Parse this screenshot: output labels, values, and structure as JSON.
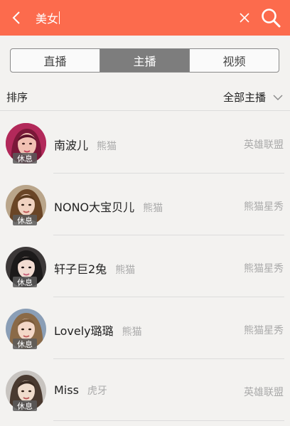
{
  "search": {
    "query": "美女"
  },
  "tabs": [
    {
      "label": "直播",
      "active": false
    },
    {
      "label": "主播",
      "active": true
    },
    {
      "label": "视频",
      "active": false
    }
  ],
  "sort": {
    "label": "排序",
    "filter_label": "全部主播"
  },
  "streamers": [
    {
      "name": "南波儿",
      "platform": "熊猫",
      "category": "英雄联盟",
      "status": "休息"
    },
    {
      "name": "NONO大宝贝儿",
      "platform": "熊猫",
      "category": "熊猫星秀",
      "status": "休息"
    },
    {
      "name": "轩子巨2兔",
      "platform": "熊猫",
      "category": "熊猫星秀",
      "status": "休息"
    },
    {
      "name": "Lovely璐璐",
      "platform": "熊猫",
      "category": "熊猫星秀",
      "status": "休息"
    },
    {
      "name": "Miss",
      "platform": "虎牙",
      "category": "英雄联盟",
      "status": "休息"
    }
  ],
  "colors": {
    "header_bg": "#fc6b4d",
    "active_tab_bg": "#7d7d7d",
    "page_bg": "#f3f2f0"
  },
  "icons": {
    "back": "back-arrow-icon",
    "clear": "clear-x-icon",
    "search": "search-icon",
    "chevron": "chevron-down-icon"
  }
}
